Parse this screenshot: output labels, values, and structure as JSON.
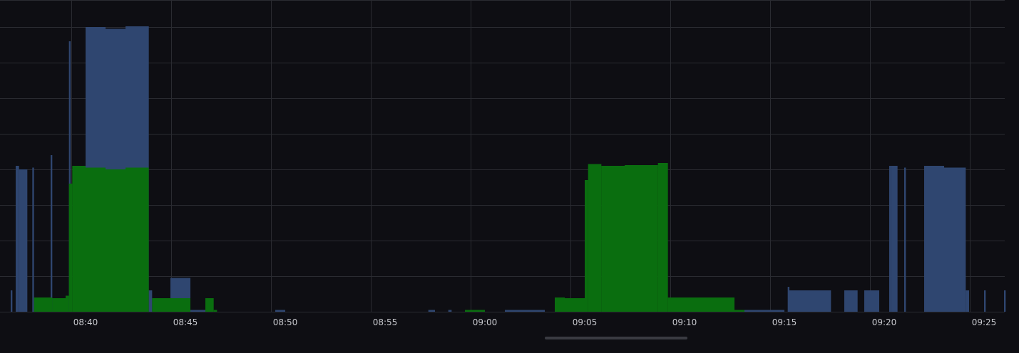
{
  "chart_data": {
    "type": "bar",
    "title": "",
    "xlabel": "",
    "ylabel": "",
    "x_ticks": [
      "08:40",
      "08:45",
      "08:50",
      "08:55",
      "09:00",
      "09:05",
      "09:10",
      "09:15",
      "09:20",
      "09:25"
    ],
    "x_range": [
      "08:36",
      "09:26"
    ],
    "ylim": [
      0,
      8
    ],
    "grid": true,
    "legend": "none",
    "colors": {
      "background": "#0e0e13",
      "grid": "#2a2b31",
      "axis_text": "#c7c8cd",
      "blue": "#2f4670",
      "green": "#0a6e0f"
    },
    "series": [
      {
        "color": "#2f4670",
        "segments": [
          {
            "start": "08:36:15",
            "end": "08:36:20",
            "value": 0.6
          },
          {
            "start": "08:36:30",
            "end": "08:36:40",
            "value": 4.1
          },
          {
            "start": "08:36:40",
            "end": "08:37:05",
            "value": 4.0
          },
          {
            "start": "08:37:20",
            "end": "08:37:25",
            "value": 4.05
          },
          {
            "start": "08:38:15",
            "end": "08:38:20",
            "value": 4.4
          },
          {
            "start": "08:39:10",
            "end": "08:39:15",
            "value": 7.6
          },
          {
            "start": "08:40:00",
            "end": "08:41:00",
            "value": 8.0
          },
          {
            "start": "08:41:00",
            "end": "08:42:00",
            "value": 7.95
          },
          {
            "start": "08:42:00",
            "end": "08:43:10",
            "value": 8.02
          },
          {
            "start": "08:43:10",
            "end": "08:43:20",
            "value": 0.6
          },
          {
            "start": "08:44:15",
            "end": "08:45:15",
            "value": 0.95
          },
          {
            "start": "08:45:15",
            "end": "08:46:00",
            "value": 0.05
          },
          {
            "start": "08:49:30",
            "end": "08:50:00",
            "value": 0.05
          },
          {
            "start": "08:57:10",
            "end": "08:57:30",
            "value": 0.05
          },
          {
            "start": "08:58:10",
            "end": "08:58:20",
            "value": 0.05
          },
          {
            "start": "09:01:00",
            "end": "09:03:00",
            "value": 0.05
          },
          {
            "start": "09:12:30",
            "end": "09:15:00",
            "value": 0.05
          },
          {
            "start": "09:15:10",
            "end": "09:15:15",
            "value": 0.7
          },
          {
            "start": "09:15:15",
            "end": "09:17:20",
            "value": 0.6
          },
          {
            "start": "09:18:00",
            "end": "09:18:40",
            "value": 0.6
          },
          {
            "start": "09:19:00",
            "end": "09:19:45",
            "value": 0.6
          },
          {
            "start": "09:20:15",
            "end": "09:20:20",
            "value": 4.1
          },
          {
            "start": "09:20:20",
            "end": "09:20:40",
            "value": 4.1
          },
          {
            "start": "09:21:00",
            "end": "09:21:05",
            "value": 4.05
          },
          {
            "start": "09:22:00",
            "end": "09:23:00",
            "value": 4.1
          },
          {
            "start": "09:23:00",
            "end": "09:24:05",
            "value": 4.05
          },
          {
            "start": "09:24:05",
            "end": "09:24:15",
            "value": 0.6
          },
          {
            "start": "09:25:00",
            "end": "09:25:05",
            "value": 0.6
          },
          {
            "start": "09:26:00",
            "end": "09:26:05",
            "value": 0.6
          }
        ]
      },
      {
        "color": "#0a6e0f",
        "segments": [
          {
            "start": "08:37:25",
            "end": "08:38:20",
            "value": 0.4
          },
          {
            "start": "08:38:20",
            "end": "08:39:00",
            "value": 0.38
          },
          {
            "start": "08:39:00",
            "end": "08:39:10",
            "value": 0.45
          },
          {
            "start": "08:39:10",
            "end": "08:39:20",
            "value": 3.6
          },
          {
            "start": "08:39:20",
            "end": "08:40:00",
            "value": 4.1
          },
          {
            "start": "08:40:00",
            "end": "08:41:00",
            "value": 4.05
          },
          {
            "start": "08:41:00",
            "end": "08:42:00",
            "value": 4.0
          },
          {
            "start": "08:42:00",
            "end": "08:43:10",
            "value": 4.05
          },
          {
            "start": "08:43:20",
            "end": "08:45:15",
            "value": 0.38
          },
          {
            "start": "08:46:00",
            "end": "08:46:25",
            "value": 0.38
          },
          {
            "start": "08:46:25",
            "end": "08:46:35",
            "value": 0.05
          },
          {
            "start": "08:59:00",
            "end": "09:00:00",
            "value": 0.05
          },
          {
            "start": "09:03:30",
            "end": "09:04:00",
            "value": 0.4
          },
          {
            "start": "09:04:00",
            "end": "09:05:00",
            "value": 0.38
          },
          {
            "start": "09:05:00",
            "end": "09:05:10",
            "value": 3.7
          },
          {
            "start": "09:05:10",
            "end": "09:05:50",
            "value": 4.15
          },
          {
            "start": "09:05:50",
            "end": "09:07:00",
            "value": 4.1
          },
          {
            "start": "09:07:00",
            "end": "09:08:40",
            "value": 4.12
          },
          {
            "start": "09:08:40",
            "end": "09:09:10",
            "value": 4.18
          },
          {
            "start": "09:09:10",
            "end": "09:09:30",
            "value": 0.4
          },
          {
            "start": "09:09:30",
            "end": "09:12:30",
            "value": 0.4
          },
          {
            "start": "09:12:30",
            "end": "09:13:00",
            "value": 0.05
          }
        ]
      }
    ]
  }
}
